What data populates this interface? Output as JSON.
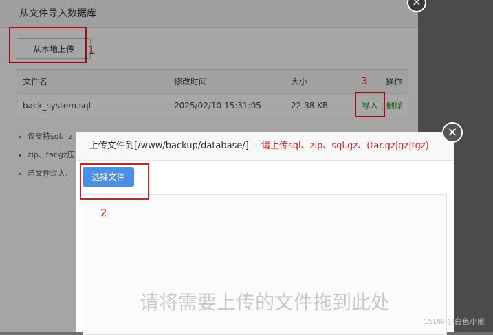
{
  "bg_dialog": {
    "title": "从文件导入数据库",
    "upload_local_label": "从本地上传",
    "table": {
      "headers": [
        "文件名",
        "修改时间",
        "大小",
        "操作"
      ],
      "row": {
        "filename": "back_system.sql",
        "modified": "2025/02/10 15:31:05",
        "size": "22.38 KB",
        "action_import": "导入",
        "action_sep": "|",
        "action_delete": "删除"
      }
    },
    "notes": [
      "仅支持sql、z",
      "zip、tar.gz压",
      "若文件过大,"
    ],
    "close": "×"
  },
  "upload_dialog": {
    "title_prefix": "上传文件到[/www/backup/database/] ---",
    "title_hint": "请上传sql、zip、sql.gz、(tar.gz|gz|tgz)",
    "choose_file": "选择文件",
    "drop_text": "请将需要上传的文件拖到此处",
    "close": "×"
  },
  "annotations": {
    "one": "1",
    "two": "2",
    "three": "3"
  },
  "watermark": "CSDN @白色小熊",
  "colors": {
    "annotation_red": "#e0191a",
    "primary_blue": "#4a90e2",
    "link_green": "#2e8b2e"
  }
}
